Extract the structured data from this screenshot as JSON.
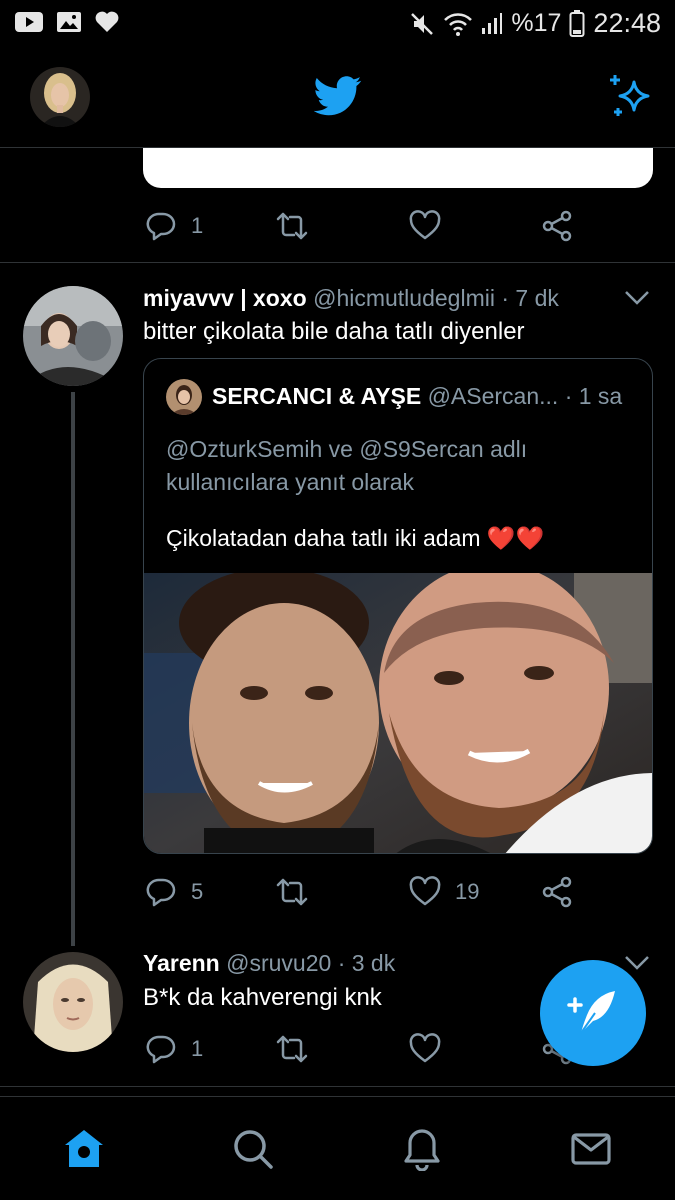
{
  "status_bar": {
    "battery_percent": "%17",
    "time": "22:48"
  },
  "header": {
    "profile_avatar": "profile-avatar",
    "logo": "twitter-bird-icon",
    "sparkle": "sparkle-icon"
  },
  "prev_tweet": {
    "reply_count": "1"
  },
  "tweet": {
    "name": "miyavvv | xoxo",
    "handle": "@hicmutludeglmii",
    "time": "· 7 dk",
    "text": "bitter çikolata bile daha tatlı diyenler",
    "reply_count": "5",
    "like_count": "19",
    "quote": {
      "name": "SERCANCI & AYŞE",
      "handle": "@ASercan...",
      "time": "· 1 sa",
      "reply_context": "@OzturkSemih ve @S9Sercan adlı kullanıcılara yanıt olarak",
      "text": "Çikolatadan daha tatlı iki adam ❤️❤️"
    }
  },
  "reply_tweet": {
    "name": "Yarenn",
    "handle": "@sruvu20",
    "time": "· 3 dk",
    "text": "B*k da kahverengi knk",
    "reply_count": "1"
  },
  "colors": {
    "accent": "#1da1f2",
    "background": "#000000",
    "muted": "#8899a6",
    "divider": "#2f3336"
  },
  "bottom_nav": {
    "items": [
      "home-icon",
      "search-icon",
      "notifications-icon",
      "messages-icon"
    ],
    "active": "home-icon"
  }
}
